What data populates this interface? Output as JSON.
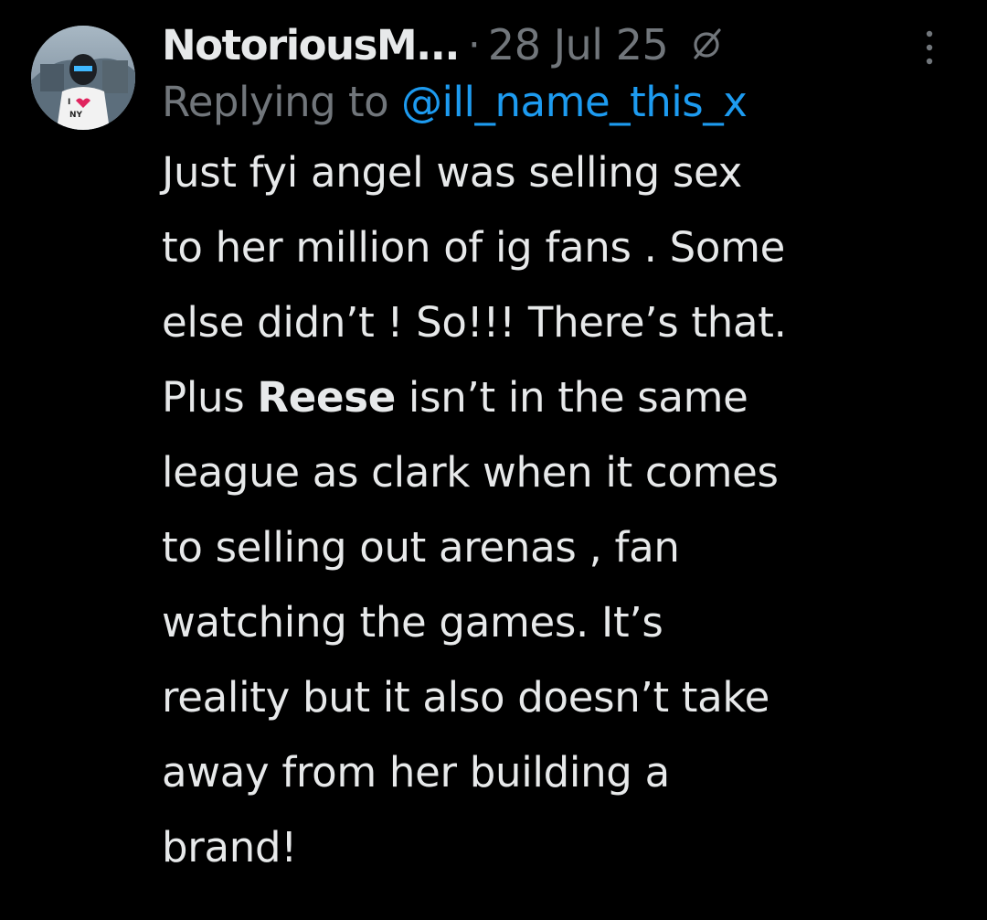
{
  "tweet": {
    "author": {
      "display_name": "NotoriousM...",
      "avatar_icon": "avatar-icon"
    },
    "separator": "·",
    "date": "28 Jul 25",
    "status_icon": "circle-slash-icon",
    "more_icon": "more-vertical-icon",
    "reply": {
      "prefix": "Replying to ",
      "handle": "@ill_name_this_x"
    },
    "body": {
      "line1": "Just fyi angel was selling sex",
      "line2": "to her million of ig fans . Some",
      "line3": "else didn’t ! So!!! There’s that.",
      "line4_before": "Plus ",
      "line4_bold": "Reese",
      "line4_after": " isn’t in the same",
      "line5": "league as clark when it comes",
      "line6": "to selling out arenas , fan",
      "line7": "watching the games. It’s",
      "line8": "reality but it also doesn’t take",
      "line9": "away from her building a",
      "line10": "brand!"
    },
    "colors": {
      "background": "#000000",
      "text": "#e7e9ea",
      "muted": "#71767b",
      "link": "#1d9bf0"
    }
  }
}
